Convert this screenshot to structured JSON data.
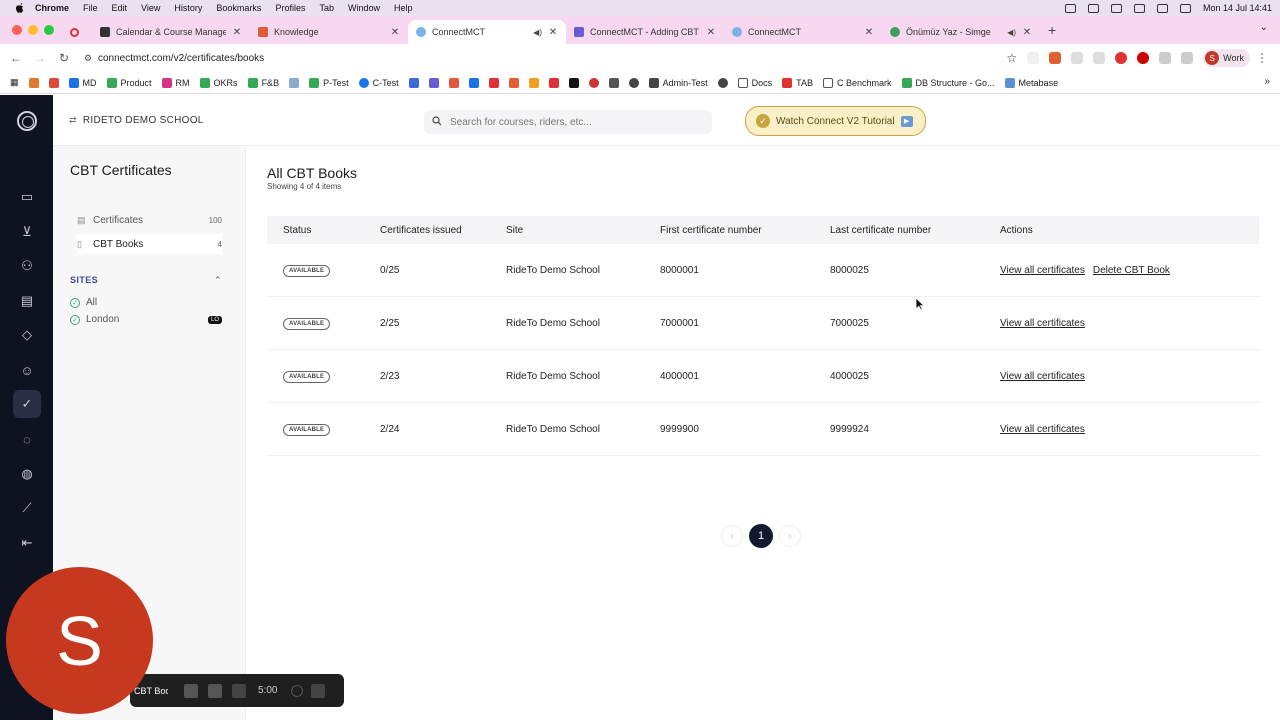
{
  "menubar": {
    "app": "Chrome",
    "items": [
      "File",
      "Edit",
      "View",
      "History",
      "Bookmarks",
      "Profiles",
      "Tab",
      "Window",
      "Help"
    ],
    "clock": "Mon 14 Jul  14:41"
  },
  "tabs": [
    {
      "title": "Calendar & Course Managem",
      "color": "#333333"
    },
    {
      "title": "Knowledge",
      "color": "#e05a3a"
    },
    {
      "title": "ConnectMCT",
      "color": "#7bb3e8",
      "active": true
    },
    {
      "title": "ConnectMCT - Adding CBT B",
      "color": "#6b5bd6"
    },
    {
      "title": "ConnectMCT",
      "color": "#7bb3e8"
    },
    {
      "title": "Önümüz Yaz - Simge",
      "color": "#3aa05a"
    }
  ],
  "address": {
    "url": "connectmct.com/v2/certificates/books",
    "profile_label": "Work",
    "profile_initial": "S"
  },
  "bookmarks": [
    {
      "label": "MD",
      "color": "#1a73e8"
    },
    {
      "label": "Product",
      "color": "#34a853"
    },
    {
      "label": "RM",
      "color": "#d63384"
    },
    {
      "label": "OKRs",
      "color": "#34a853"
    },
    {
      "label": "F&B",
      "color": "#34a853"
    },
    {
      "label": "P-Test",
      "color": "#34a853"
    },
    {
      "label": "C-Test",
      "color": "#1a73e8"
    },
    {
      "label": "Admin-Test",
      "color": "#444444"
    },
    {
      "label": "Docs",
      "color": "#555555"
    },
    {
      "label": "TAB",
      "color": "#e03030"
    },
    {
      "label": "C Benchmark",
      "color": "#555555"
    },
    {
      "label": "DB Structure - Go...",
      "color": "#34a853"
    },
    {
      "label": "Metabase",
      "color": "#5a8fd6"
    }
  ],
  "header": {
    "school": "RIDETO DEMO SCHOOL",
    "search_placeholder": "Search for courses, riders, etc...",
    "tutorial_label": "Watch Connect V2 Tutorial"
  },
  "left_panel": {
    "title": "CBT Certificates",
    "items": [
      {
        "label": "Certificates",
        "count": "100"
      },
      {
        "label": "CBT Books",
        "count": "4"
      }
    ],
    "sites_heading": "SITES",
    "sites": [
      {
        "label": "All"
      },
      {
        "label": "London",
        "badge": "LO"
      }
    ]
  },
  "main": {
    "title": "All CBT Books",
    "subtitle": "Showing 4 of 4 items",
    "columns": [
      "Status",
      "Certificates issued",
      "Site",
      "First certificate number",
      "Last certificate number",
      "Actions"
    ],
    "rows": [
      {
        "status": "AVAILABLE",
        "issued": "0/25",
        "site": "RideTo Demo School",
        "first": "8000001",
        "last": "8000025",
        "action1": "View all certificates",
        "action2": "Delete CBT Book"
      },
      {
        "status": "AVAILABLE",
        "issued": "2/25",
        "site": "RideTo Demo School",
        "first": "7000001",
        "last": "7000025",
        "action1": "View all certificates"
      },
      {
        "status": "AVAILABLE",
        "issued": "2/23",
        "site": "RideTo Demo School",
        "first": "4000001",
        "last": "4000025",
        "action1": "View all certificates"
      },
      {
        "status": "AVAILABLE",
        "issued": "2/24",
        "site": "RideTo Demo School",
        "first": "9999900",
        "last": "9999924",
        "action1": "View all certificates"
      }
    ],
    "current_page": "1"
  },
  "recording": {
    "avatar_letter": "S",
    "label": "CBT Boo",
    "time": "5:00"
  }
}
